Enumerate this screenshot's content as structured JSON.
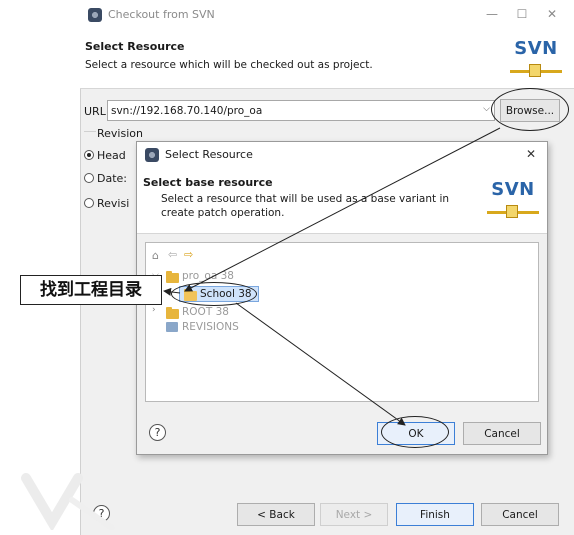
{
  "outer_window": {
    "title": "Checkout from SVN",
    "controls": {
      "minimize": "—",
      "maximize": "☐",
      "close": "✕"
    },
    "header": {
      "title": "Select Resource",
      "subtitle": "Select a resource which will be checked out as project.",
      "logo_text": "SVN"
    },
    "url": {
      "label": "URL:",
      "value": "svn://192.168.70.140/pro_oa",
      "browse_label": "Browse..."
    },
    "revision": {
      "group_label": "Revision",
      "options": [
        {
          "label": "Head",
          "selected": true
        },
        {
          "label": "Date:",
          "selected": false
        },
        {
          "label": "Revisi",
          "selected": false
        }
      ]
    },
    "footer": {
      "help": "?",
      "back_label": "< Back",
      "next_label": "Next >",
      "finish_label": "Finish",
      "cancel_label": "Cancel"
    }
  },
  "inner_dialog": {
    "title": "Select Resource",
    "close": "✕",
    "header": {
      "title": "Select base resource",
      "subtitle_line1": "Select a resource that will be used as a base variant in",
      "subtitle_line2": "create patch operation.",
      "logo_text": "SVN"
    },
    "tree": {
      "items": [
        {
          "label": "pro_oa 38",
          "expanded": true,
          "level": 0
        },
        {
          "label": "School 38",
          "selected": true,
          "level": 1
        },
        {
          "label": "ROOT 38",
          "expanded": false,
          "level": 0
        },
        {
          "label": "REVISIONS",
          "level": 0
        }
      ]
    },
    "footer": {
      "help": "?",
      "ok_label": "OK",
      "cancel_label": "Cancel"
    }
  },
  "annotation": {
    "text": "找到工程目录"
  },
  "colors": {
    "selection": "#cfe3fb",
    "svn_blue": "#2a64a8",
    "accent_gold": "#d8a81c"
  }
}
